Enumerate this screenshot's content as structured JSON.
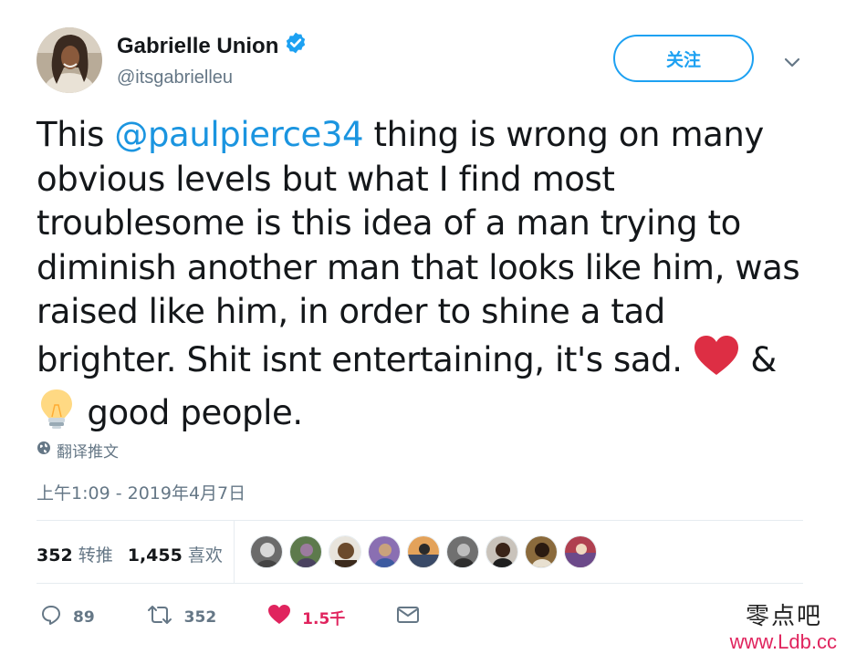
{
  "user": {
    "display_name": "Gabrielle Union",
    "handle": "@itsgabrielleu",
    "verified": true,
    "avatar_icon": "profile-photo"
  },
  "header": {
    "follow_label": "关注",
    "more_icon": "chevron-down-icon"
  },
  "tweet": {
    "part1": "This ",
    "mention": "@paulpierce34",
    "part2": " thing is wrong on many obvious levels but what I find most troublesome is this idea of a man trying to diminish another man that looks like him, was raised like him, in order to shine a tad brighter. Shit isnt entertaining, it's sad. ",
    "part3": " & ",
    "part4": " good people.",
    "emojis": [
      "red-heart",
      "light-bulb"
    ]
  },
  "translate_label": "翻译推文",
  "timestamp": "上午1:09 - 2019年4月7日",
  "stats": {
    "retweets_count": "352",
    "retweets_label": "转推",
    "likes_count": "1,455",
    "likes_label": "喜欢"
  },
  "actions": {
    "reply_count": "89",
    "retweet_count": "352",
    "like_count": "1.5千"
  },
  "colors": {
    "accent": "#1da1f2",
    "mention": "#1b95e0",
    "like": "#e0245e",
    "muted": "#657786"
  },
  "watermark": {
    "chinese": "零点吧",
    "url": "www.Ldb.cc"
  }
}
